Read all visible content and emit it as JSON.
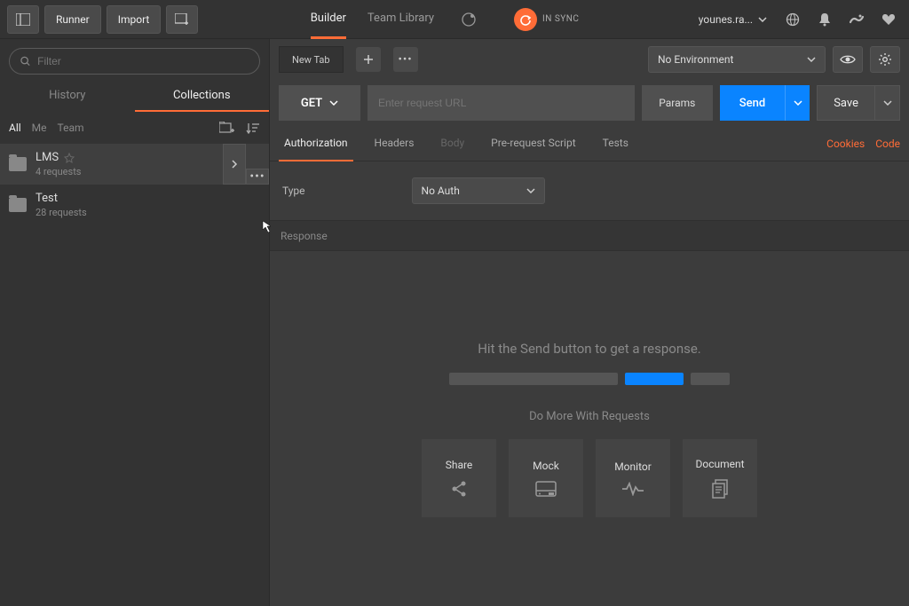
{
  "topbar": {
    "runner": "Runner",
    "import": "Import",
    "tabs": {
      "builder": "Builder",
      "library": "Team Library"
    },
    "sync": "IN SYNC",
    "user": "younes.ra..."
  },
  "sidebar": {
    "filter_placeholder": "Filter",
    "tabs": {
      "history": "History",
      "collections": "Collections"
    },
    "scope": {
      "all": "All",
      "me": "Me",
      "team": "Team"
    },
    "items": [
      {
        "name": "LMS",
        "count": "4 requests"
      },
      {
        "name": "Test",
        "count": "28 requests"
      }
    ]
  },
  "request": {
    "tab_name": "New Tab",
    "method": "GET",
    "url_placeholder": "Enter request URL",
    "params": "Params",
    "send": "Send",
    "save": "Save",
    "env": "No Environment",
    "subtabs": {
      "auth": "Authorization",
      "headers": "Headers",
      "body": "Body",
      "prerequest": "Pre-request Script",
      "tests": "Tests"
    },
    "links": {
      "cookies": "Cookies",
      "code": "Code"
    },
    "auth": {
      "type_label": "Type",
      "type_value": "No Auth"
    }
  },
  "response": {
    "header": "Response",
    "hint": "Hit the Send button to get a response.",
    "do_more": "Do More With Requests",
    "cards": {
      "share": "Share",
      "mock": "Mock",
      "monitor": "Monitor",
      "document": "Document"
    }
  }
}
